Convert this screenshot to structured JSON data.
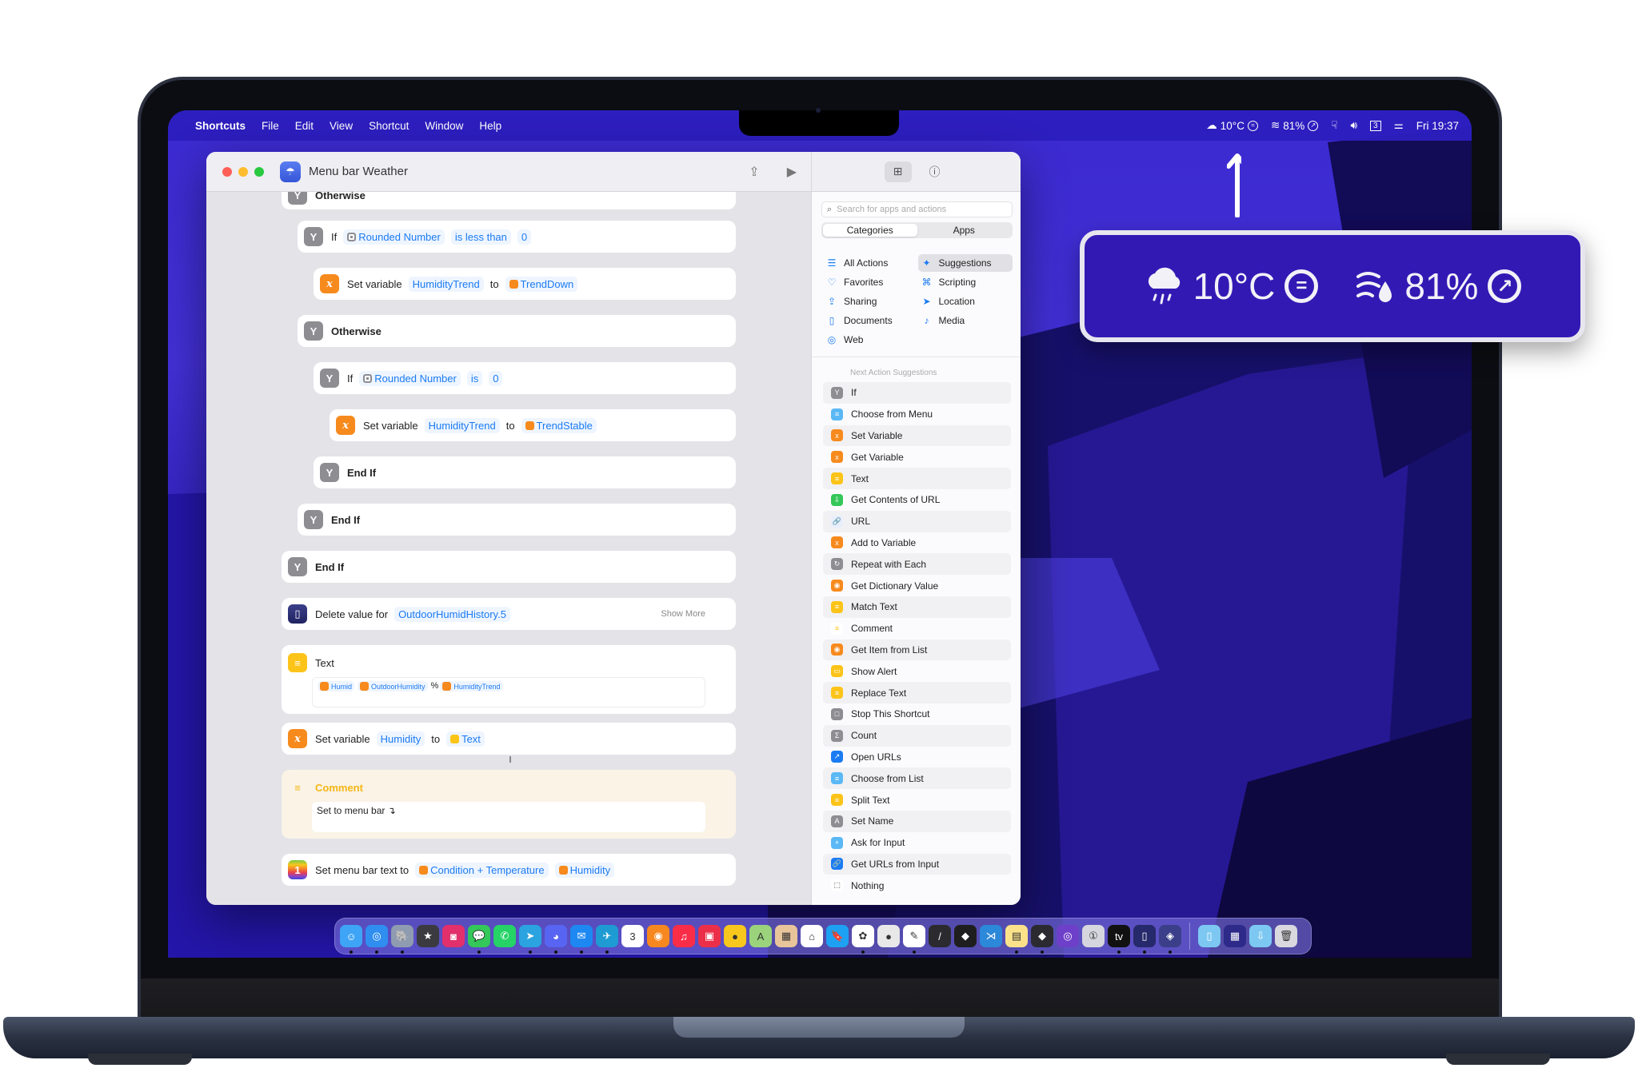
{
  "menubar": {
    "app_name": "Shortcuts",
    "menus": [
      "File",
      "Edit",
      "View",
      "Shortcut",
      "Window",
      "Help"
    ],
    "status": {
      "weather_text": "10°C",
      "weather_trend_icon": "equal-circle-icon",
      "humidity_text": "81%",
      "humidity_trend_icon": "arrow-up-right-circle-icon",
      "clock": "Fri 19:37",
      "calendar_day": "3"
    }
  },
  "window": {
    "title": "Menu bar Weather",
    "actions": [
      {
        "type": "otherwise",
        "label": "Otherwise"
      },
      {
        "type": "if",
        "label": "If",
        "tokens": [
          "Rounded Number",
          "is less than",
          "0"
        ]
      },
      {
        "type": "setvar",
        "label": "Set variable",
        "var": "HumidityTrend",
        "to": "to",
        "value": "TrendDown"
      },
      {
        "type": "otherwise",
        "label": "Otherwise"
      },
      {
        "type": "if",
        "label": "If",
        "tokens": [
          "Rounded Number",
          "is",
          "0"
        ]
      },
      {
        "type": "setvar",
        "label": "Set variable",
        "var": "HumidityTrend",
        "to": "to",
        "value": "TrendStable"
      },
      {
        "type": "endif",
        "label": "End If"
      },
      {
        "type": "endif",
        "label": "End If"
      },
      {
        "type": "endif",
        "label": "End If"
      },
      {
        "type": "delete",
        "label": "Delete value for",
        "key": "OutdoorHumidHistory.5",
        "more": "Show More"
      },
      {
        "type": "text",
        "label": "Text",
        "tokens": [
          "Humid",
          "OutdoorHumidity",
          "%",
          "HumidityTrend"
        ]
      },
      {
        "type": "setvar",
        "label": "Set variable",
        "var": "Humidity",
        "to": "to",
        "value": "Text"
      },
      {
        "type": "comment",
        "label": "Comment",
        "body": "Set to menu bar ↴"
      },
      {
        "type": "menubar",
        "label": "Set menu bar text to",
        "tokens": [
          "Condition + Temperature",
          "Humidity"
        ]
      }
    ]
  },
  "library": {
    "search_placeholder": "Search for apps and actions",
    "tabs": [
      "Categories",
      "Apps"
    ],
    "active_tab": "Categories",
    "categories_left": [
      {
        "label": "All Actions",
        "icon": "☰"
      },
      {
        "label": "Favorites",
        "icon": "♡"
      },
      {
        "label": "Sharing",
        "icon": "⇪"
      },
      {
        "label": "Documents",
        "icon": "▯"
      },
      {
        "label": "Web",
        "icon": "◎"
      }
    ],
    "categories_right": [
      {
        "label": "Suggestions",
        "icon": "✦",
        "selected": true
      },
      {
        "label": "Scripting",
        "icon": "⌘"
      },
      {
        "label": "Location",
        "icon": "➤"
      },
      {
        "label": "Media",
        "icon": "♪"
      }
    ],
    "suggestions_title": "Next Action Suggestions",
    "suggestions": [
      {
        "label": "If",
        "color": "#8d8d92",
        "glyph": "Y"
      },
      {
        "label": "Choose from Menu",
        "color": "#5ab8f5",
        "glyph": "≡"
      },
      {
        "label": "Set Variable",
        "color": "#f78a1d",
        "glyph": "x"
      },
      {
        "label": "Get Variable",
        "color": "#f78a1d",
        "glyph": "x"
      },
      {
        "label": "Text",
        "color": "#fcc419",
        "glyph": "≡"
      },
      {
        "label": "Get Contents of URL",
        "color": "#34c759",
        "glyph": "⇩"
      },
      {
        "label": "URL",
        "color": "#e8eefc",
        "glyph": "🔗"
      },
      {
        "label": "Add to Variable",
        "color": "#f78a1d",
        "glyph": "x"
      },
      {
        "label": "Repeat with Each",
        "color": "#8d8d92",
        "glyph": "↻"
      },
      {
        "label": "Get Dictionary Value",
        "color": "#f78a1d",
        "glyph": "◉"
      },
      {
        "label": "Match Text",
        "color": "#fcc419",
        "glyph": "≡"
      },
      {
        "label": "Comment",
        "color": "#ffffff",
        "glyph": "≡"
      },
      {
        "label": "Get Item from List",
        "color": "#f78a1d",
        "glyph": "◉"
      },
      {
        "label": "Show Alert",
        "color": "#fcc419",
        "glyph": "▭"
      },
      {
        "label": "Replace Text",
        "color": "#fcc419",
        "glyph": "≡"
      },
      {
        "label": "Stop This Shortcut",
        "color": "#8d8d92",
        "glyph": "□"
      },
      {
        "label": "Count",
        "color": "#8d8d92",
        "glyph": "Σ"
      },
      {
        "label": "Open URLs",
        "color": "#1b7bf3",
        "glyph": "↗"
      },
      {
        "label": "Choose from List",
        "color": "#5ab8f5",
        "glyph": "≡"
      },
      {
        "label": "Split Text",
        "color": "#fcc419",
        "glyph": "≡"
      },
      {
        "label": "Set Name",
        "color": "#8d8d92",
        "glyph": "A"
      },
      {
        "label": "Ask for Input",
        "color": "#5ab8f5",
        "glyph": "+"
      },
      {
        "label": "Get URLs from Input",
        "color": "#1b7bf3",
        "glyph": "🔗"
      },
      {
        "label": "Nothing",
        "color": "#ffffff",
        "glyph": "⬚"
      }
    ]
  },
  "callout": {
    "temperature": "10°C",
    "temperature_trend": "=",
    "humidity": "81%",
    "humidity_trend": "↗"
  },
  "dock": {
    "apps": [
      {
        "name": "Finder",
        "color": "#3ea4f5",
        "glyph": "☺",
        "running": true
      },
      {
        "name": "Safari",
        "color": "#2f8ef0",
        "glyph": "◎",
        "running": true
      },
      {
        "name": "TablePlus",
        "color": "#8f9bb0",
        "glyph": "🐘",
        "running": true
      },
      {
        "name": "Reeder",
        "color": "#3a3a40",
        "glyph": "★",
        "running": false
      },
      {
        "name": "Instagram",
        "color": "#e1306c",
        "glyph": "◙",
        "running": false
      },
      {
        "name": "Messages",
        "color": "#34c759",
        "glyph": "💬",
        "running": true
      },
      {
        "name": "WhatsApp",
        "color": "#25d366",
        "glyph": "✆",
        "running": false
      },
      {
        "name": "Telegram",
        "color": "#2aa3e0",
        "glyph": "➤",
        "running": true
      },
      {
        "name": "Discord",
        "color": "#5865f2",
        "glyph": "◕",
        "running": true
      },
      {
        "name": "Mail",
        "color": "#1e88f2",
        "glyph": "✉",
        "running": true
      },
      {
        "name": "Airmail",
        "color": "#1e9bd3",
        "glyph": "✈",
        "running": true
      },
      {
        "name": "Calendar",
        "color": "#ffffff",
        "glyph": "3",
        "running": false
      },
      {
        "name": "Overcast",
        "color": "#f7881f",
        "glyph": "◉",
        "running": false
      },
      {
        "name": "Music",
        "color": "#fa2d48",
        "glyph": "♫",
        "running": false
      },
      {
        "name": "Presentations",
        "color": "#ec2f48",
        "glyph": "▣",
        "running": false
      },
      {
        "name": "Bartender",
        "color": "#f7c71d",
        "glyph": "●",
        "running": false
      },
      {
        "name": "Maps",
        "color": "#9ad37c",
        "glyph": "A",
        "running": false
      },
      {
        "name": "Keka",
        "color": "#e8c49b",
        "glyph": "▦",
        "running": false
      },
      {
        "name": "Home",
        "color": "#ffffff",
        "glyph": "⌂",
        "running": false
      },
      {
        "name": "Day One",
        "color": "#1ea1f2",
        "glyph": "🔖",
        "running": false
      },
      {
        "name": "Photos",
        "color": "#ffffff",
        "glyph": "✿",
        "running": true
      },
      {
        "name": "Sphere",
        "color": "#e8e8e8",
        "glyph": "●",
        "running": false
      },
      {
        "name": "Pixelmator",
        "color": "#ffffff",
        "glyph": "✎",
        "running": true
      },
      {
        "name": "Raycast",
        "color": "#2b2b2f",
        "glyph": "/",
        "running": false
      },
      {
        "name": "Figma",
        "color": "#1e1e1e",
        "glyph": "◆",
        "running": false
      },
      {
        "name": "VS Code",
        "color": "#2c88d9",
        "glyph": "⋊",
        "running": false
      },
      {
        "name": "Notes",
        "color": "#fbe28a",
        "glyph": "▤",
        "running": true
      },
      {
        "name": "Obsidian",
        "color": "#2a2a30",
        "glyph": "◆",
        "running": true
      },
      {
        "name": "GitHub Desktop",
        "color": "#6e40c9",
        "glyph": "◎",
        "running": false
      },
      {
        "name": "1Password",
        "color": "#d6d6de",
        "glyph": "①",
        "running": false
      },
      {
        "name": "Apple TV",
        "color": "#111111",
        "glyph": "tv",
        "running": true
      },
      {
        "name": "Data Jar",
        "color": "#26296b",
        "glyph": "▯",
        "running": true
      },
      {
        "name": "Shortcuts",
        "color": "#3b3f8a",
        "glyph": "◈",
        "running": true
      }
    ],
    "folders": [
      {
        "name": "Documents folder",
        "color": "#7cc8f2",
        "glyph": "▯"
      },
      {
        "name": "Screenshot",
        "color": "#2d2a8a",
        "glyph": "▦"
      },
      {
        "name": "Downloads folder",
        "color": "#7cc8f2",
        "glyph": "⇩"
      },
      {
        "name": "Trash",
        "color": "#d8d8de",
        "glyph": "🗑"
      }
    ]
  }
}
